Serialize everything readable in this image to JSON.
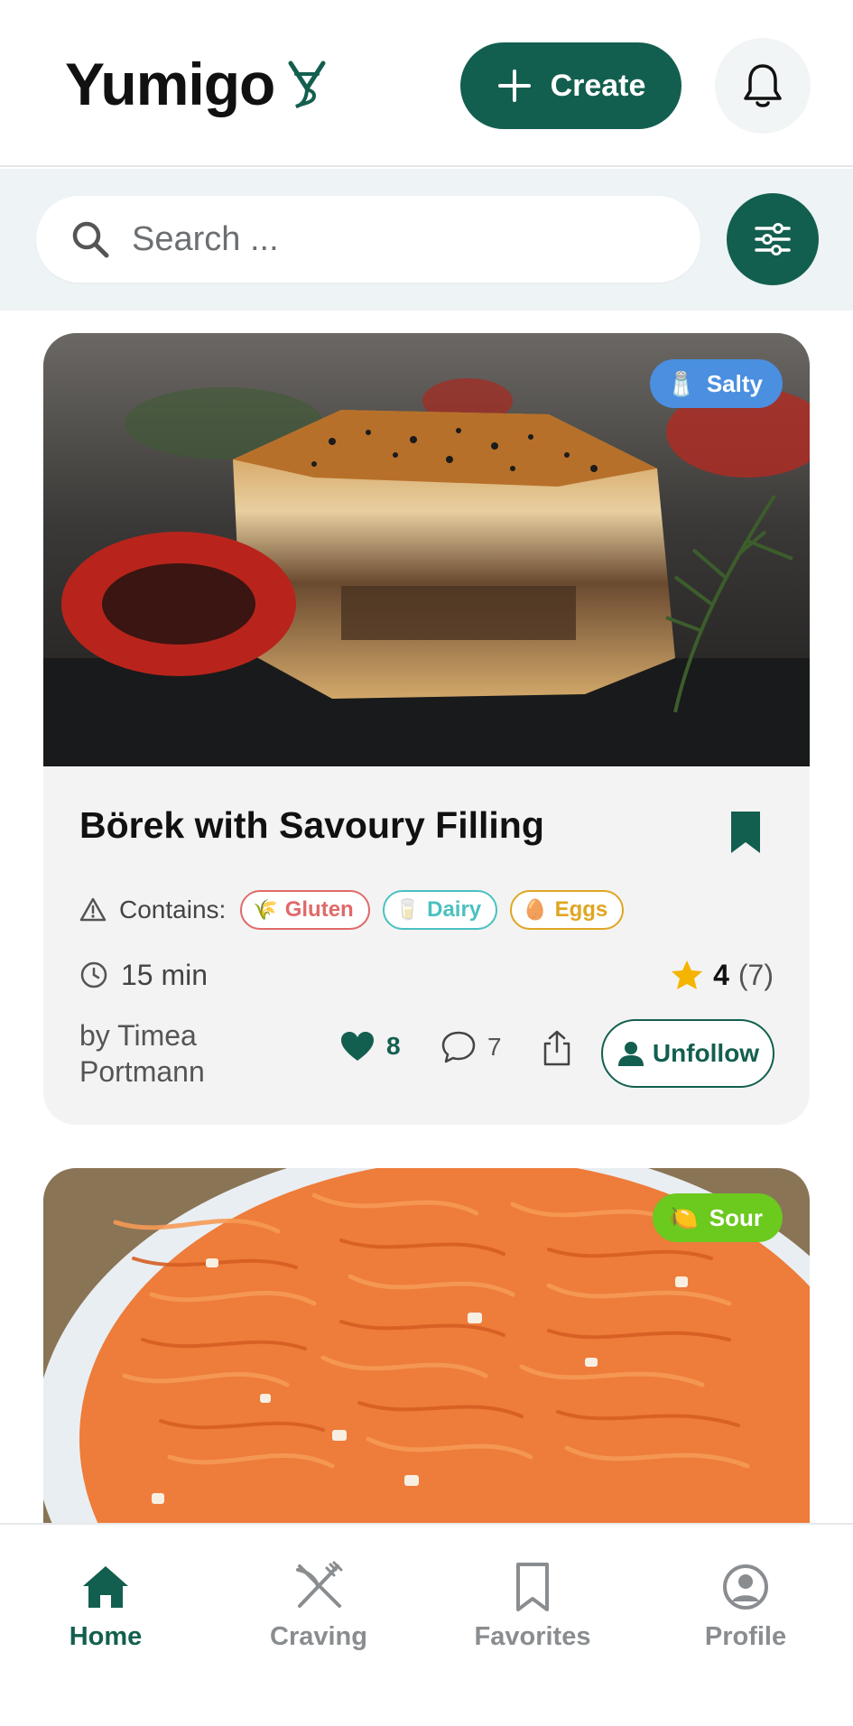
{
  "app": {
    "name": "Yumigo",
    "brand_color": "#135f4f"
  },
  "header": {
    "create_label": "Create",
    "icons": [
      "plus-icon",
      "bell-icon"
    ]
  },
  "search": {
    "placeholder": "Search ...",
    "value": ""
  },
  "recipes": [
    {
      "title": "Börek with Savoury Filling",
      "taste": {
        "emoji": "🧂",
        "label": "Salty",
        "color": "#4a8fe0"
      },
      "contains_label": "Contains:",
      "allergens": [
        {
          "emoji": "🌾",
          "label": "Gluten",
          "color": "#e06a6a"
        },
        {
          "emoji": "🥛",
          "label": "Dairy",
          "color": "#4cc0c0"
        },
        {
          "emoji": "🥚",
          "label": "Eggs",
          "color": "#e0a622"
        }
      ],
      "time": "15 min",
      "rating": "4",
      "rating_count": "(7)",
      "author": "by Timea Portmann",
      "likes": "8",
      "comments": "7",
      "follow_label": "Unfollow",
      "bookmarked": true
    },
    {
      "taste": {
        "emoji": "🍋",
        "label": "Sour",
        "color": "#6cc91e"
      }
    }
  ],
  "nav": [
    {
      "label": "Home",
      "icon": "home-icon",
      "active": true
    },
    {
      "label": "Craving",
      "icon": "fork-knife-icon",
      "active": false
    },
    {
      "label": "Favorites",
      "icon": "bookmark-icon",
      "active": false
    },
    {
      "label": "Profile",
      "icon": "profile-icon",
      "active": false
    }
  ]
}
